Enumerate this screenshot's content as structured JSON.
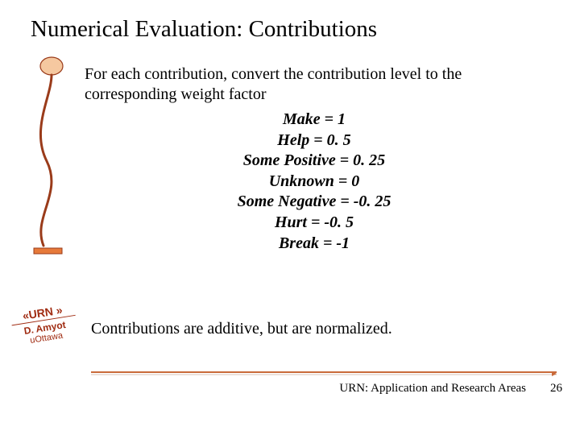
{
  "title": "Numerical Evaluation: Contributions",
  "intro": "For each contribution, convert the contribution level to the corresponding weight factor",
  "weights": {
    "make": "Make = 1",
    "help": "Help = 0. 5",
    "somepos": "Some Positive = 0. 25",
    "unknown": "Unknown = 0",
    "someneg": "Some Negative = -0. 25",
    "hurt": "Hurt = -0. 5",
    "break": "Break = -1"
  },
  "additive": "Contributions are additive, but are normalized.",
  "urn": {
    "label": "«URN »",
    "author": "D. Amyot",
    "org": "uOttawa"
  },
  "footer": "URN: Application and Research Areas",
  "page": "26"
}
